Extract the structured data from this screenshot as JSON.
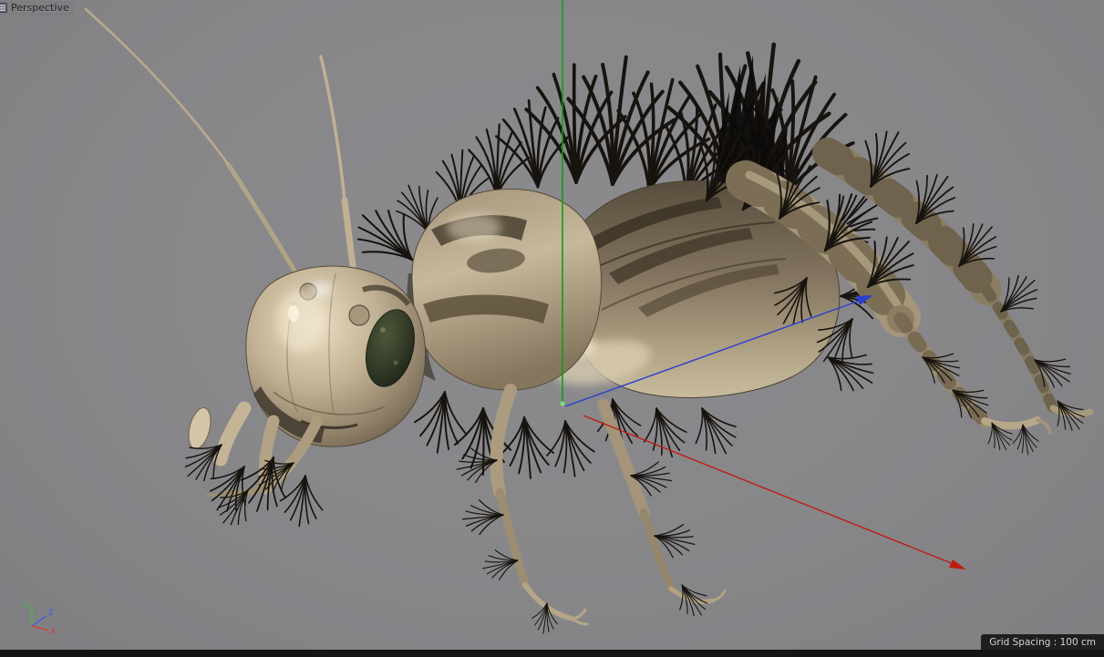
{
  "viewport": {
    "view_label": "Perspective"
  },
  "statusbar": {
    "grid_spacing": "Grid Spacing : 100 cm"
  },
  "gizmo": {
    "x_label": "X",
    "y_label": "Y",
    "z_label": "Z"
  },
  "colors": {
    "viewport_bg": "#87878a",
    "axis_x": "#e03a30",
    "axis_y": "#35c435",
    "axis_z": "#4455e0",
    "manip_x": "#bf1c12",
    "manip_y": "#0aa011",
    "manip_z": "#2b3fd0",
    "bottom_bar": "#141414",
    "chip_bg": "#1f1f1f",
    "chip_text": "#d6d6d6"
  },
  "scene": {
    "model": "cricket"
  }
}
